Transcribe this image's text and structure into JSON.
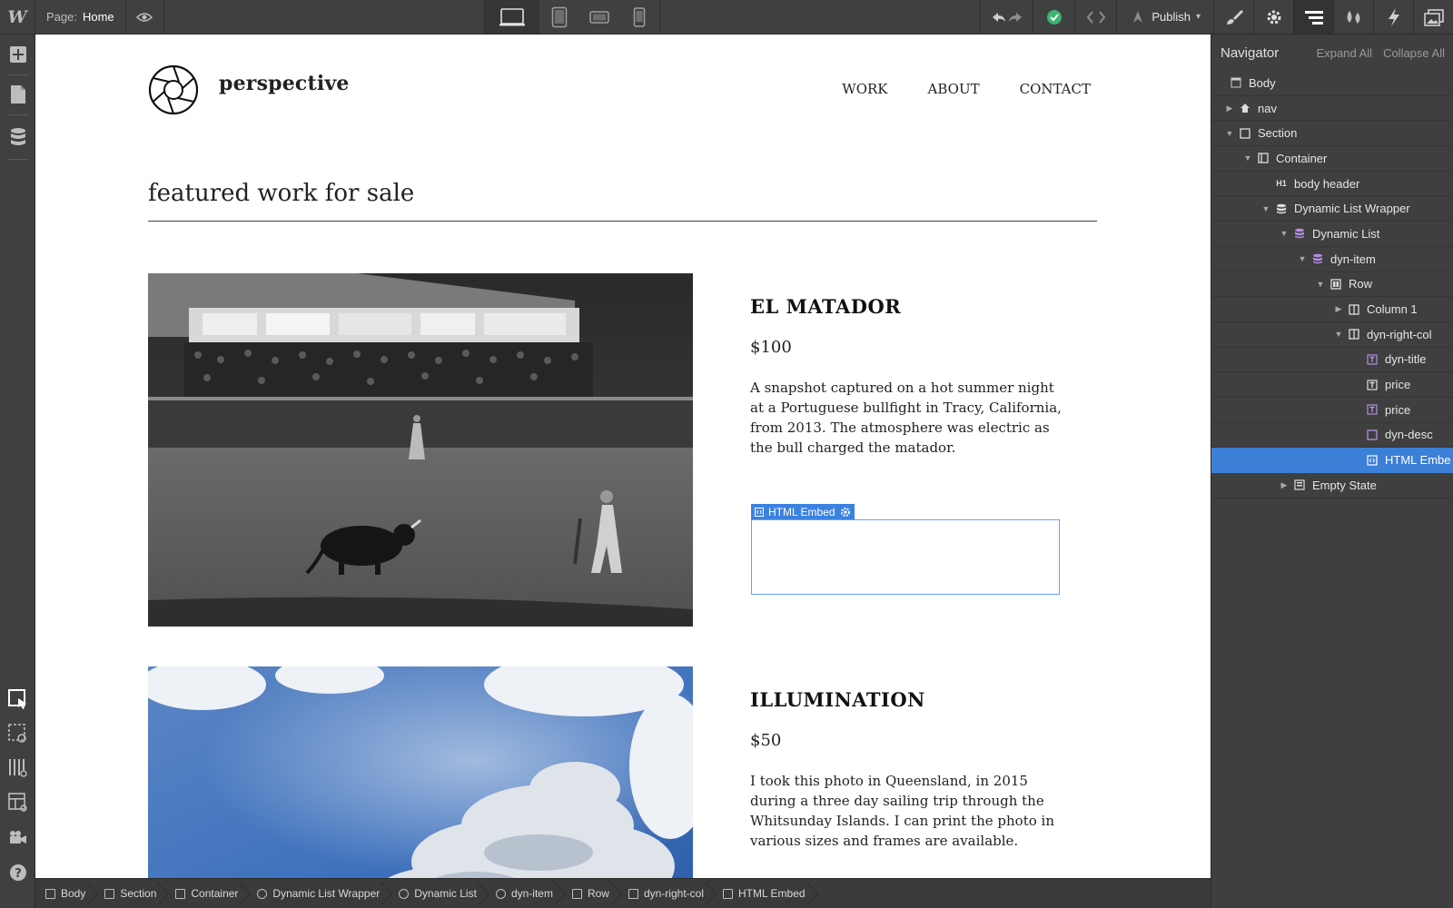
{
  "topbar": {
    "page_label": "Page:",
    "page_name": "Home",
    "publish_label": "Publish"
  },
  "site": {
    "brand": "perspective",
    "nav": [
      "WORK",
      "ABOUT",
      "CONTACT"
    ],
    "section_title": "featured work for sale"
  },
  "items": [
    {
      "title": "EL MATADOR",
      "price": "$100",
      "desc": "A snapshot captured on a hot summer night at a Portuguese bullfight in Tracy, California, from 2013. The atmosphere was electric as the bull charged the matador."
    },
    {
      "title": "ILLUMINATION",
      "price": "$50",
      "desc": "I took this photo in Queensland, in 2015 during a three day sailing trip through the Whitsunday Islands. I can print the photo in various sizes and frames are available."
    }
  ],
  "embed": {
    "tag_label": "HTML Embed"
  },
  "navigator": {
    "title": "Navigator",
    "expand_all": "Expand All",
    "collapse_all": "Collapse All",
    "rows": [
      {
        "label": "Body",
        "icon": "body-icon"
      },
      {
        "label": "nav",
        "icon": "home-icon"
      },
      {
        "label": "Section",
        "icon": "section-icon"
      },
      {
        "label": "Container",
        "icon": "container-icon"
      },
      {
        "label": "body header",
        "icon": "heading-icon"
      },
      {
        "label": "Dynamic List Wrapper",
        "icon": "database-icon"
      },
      {
        "label": "Dynamic List",
        "icon": "database-icon"
      },
      {
        "label": "dyn-item",
        "icon": "database-icon"
      },
      {
        "label": "Row",
        "icon": "row-icon"
      },
      {
        "label": "Column 1",
        "icon": "column-icon"
      },
      {
        "label": "dyn-right-col",
        "icon": "column-icon"
      },
      {
        "label": "dyn-title",
        "icon": "text-icon"
      },
      {
        "label": "price",
        "icon": "text-icon"
      },
      {
        "label": "price",
        "icon": "text-icon"
      },
      {
        "label": "dyn-desc",
        "icon": "block-icon"
      },
      {
        "label": "HTML Embe",
        "icon": "embed-icon"
      },
      {
        "label": "Empty State",
        "icon": "empty-state-icon"
      }
    ]
  },
  "breadcrumbs": [
    "Body",
    "Section",
    "Container",
    "Dynamic List Wrapper",
    "Dynamic List",
    "dyn-item",
    "Row",
    "dyn-right-col",
    "HTML Embed"
  ],
  "colors": {
    "selection": "#3c7fd6",
    "embed_accent": "#3b82e0",
    "publish_ok": "#3cb371"
  }
}
